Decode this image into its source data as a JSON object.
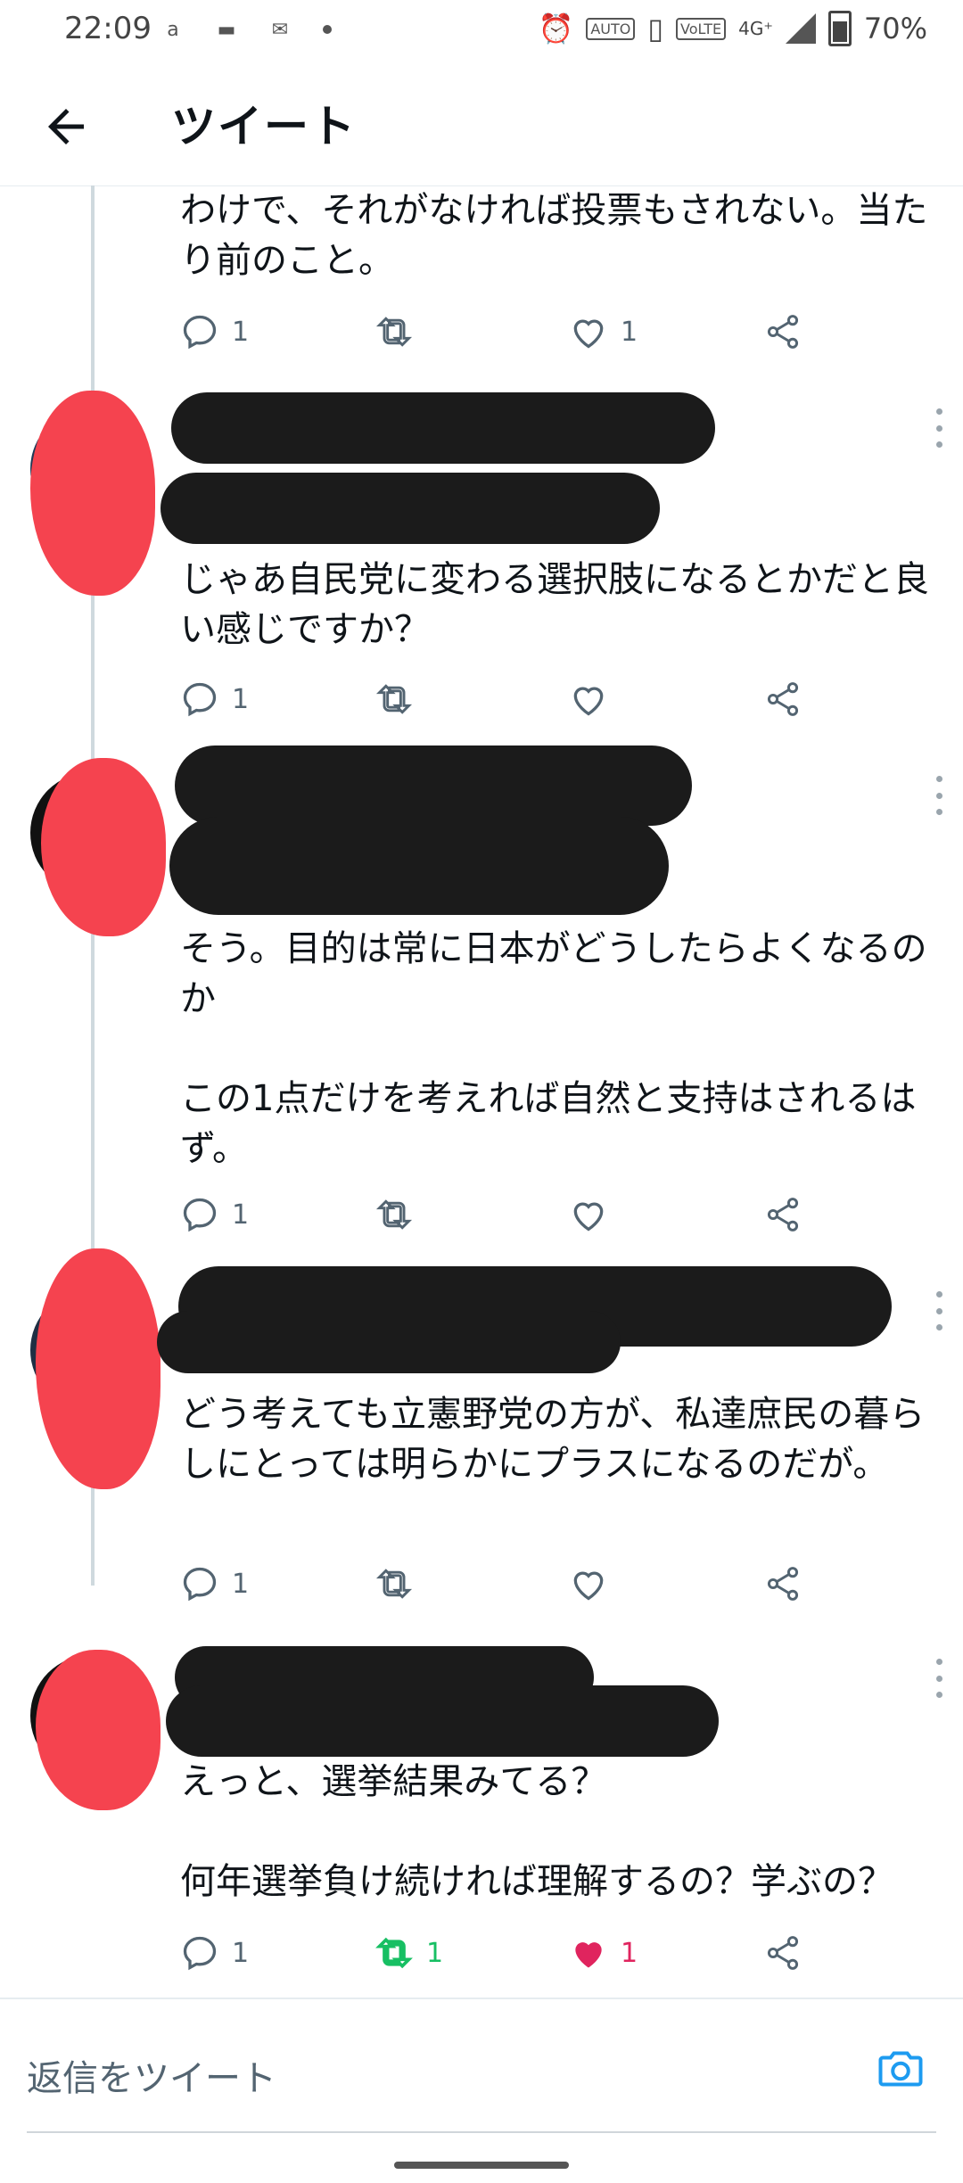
{
  "status_bar": {
    "time": "22:09",
    "battery": "70%",
    "network": "4G⁺"
  },
  "header": {
    "title": "ツイート"
  },
  "tweets": [
    {
      "text": "わけで、それがなければ投票もされない。当たり前のこと。",
      "replies": "1",
      "retweets": "",
      "likes": "1"
    },
    {
      "text": "じゃあ自民党に変わる選択肢になるとかだと良い感じですか？",
      "replies": "1",
      "retweets": "",
      "likes": ""
    },
    {
      "text": "そう。目的は常に日本がどうしたらよくなるのか\n\nこの1点だけを考えれば自然と支持はされるはず。",
      "replies": "1",
      "retweets": "",
      "likes": ""
    },
    {
      "text": "どう考えても立憲野党の方が、私達庶民の暮らしにとっては明らかにプラスになるのだが。",
      "replies": "1",
      "retweets": "",
      "likes": ""
    },
    {
      "text": "えっと、選挙結果みてる？\n\n何年選挙負け続ければ理解するの？学ぶの？",
      "replies": "1",
      "retweets": "1",
      "likes": "1"
    }
  ],
  "reply_bar": {
    "placeholder": "返信をツイート"
  },
  "colors": {
    "retweet_active": "#17bf63",
    "like_active": "#e0245e",
    "icon_gray": "#536471",
    "camera_blue": "#1d9bf0"
  }
}
